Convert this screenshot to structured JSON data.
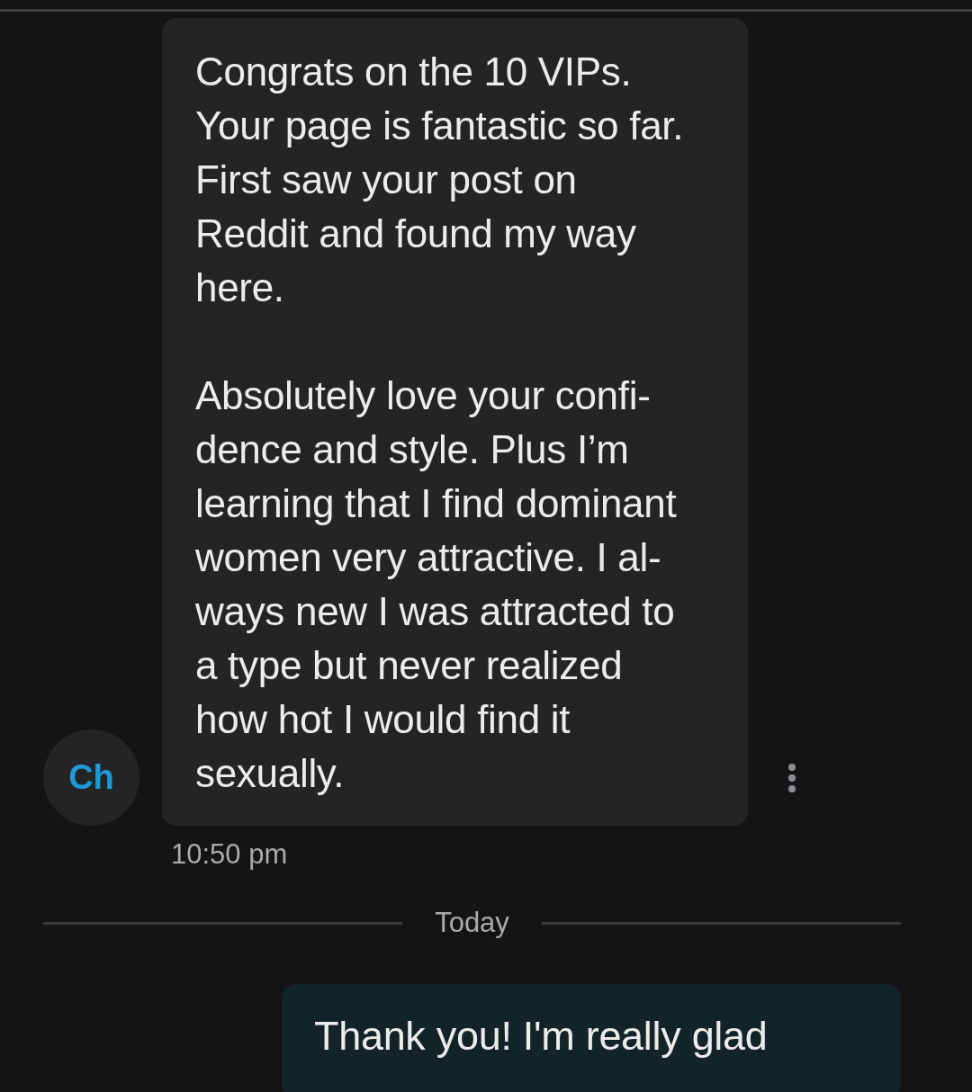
{
  "messages": [
    {
      "avatar": "Ch",
      "paragraphs": [
        [
          "Congrats on the 10 VIPs.",
          "Your page is fantastic so far.",
          "First saw your post on",
          "Reddit and found my way",
          "here."
        ],
        [
          "Absolutely love your confi-",
          "dence and style. Plus I’m",
          "learning that I find dominant",
          "women very attractive. I al-",
          "ways new I was attracted to",
          "a type but never realized",
          "how hot I would find it",
          "sexually."
        ]
      ],
      "time": "10:50 pm"
    }
  ],
  "date_divider": "Today",
  "outgoing": [
    {
      "paragraphs": [
        [
          "Thank you! I'm really glad"
        ]
      ]
    }
  ]
}
